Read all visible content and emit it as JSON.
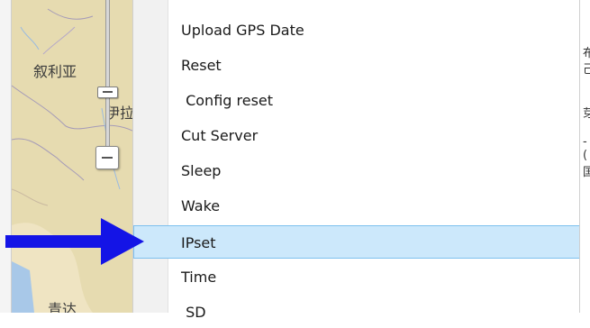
{
  "map": {
    "labels": [
      "叙利亚",
      "伊拉",
      "青达"
    ]
  },
  "menu": {
    "items": [
      {
        "label": "Upload GPS Date",
        "selected": false
      },
      {
        "label": "Reset",
        "selected": false
      },
      {
        "label": " Config reset",
        "selected": false
      },
      {
        "label": "Cut Server",
        "selected": false
      },
      {
        "label": "Sleep",
        "selected": false
      },
      {
        "label": "Wake",
        "selected": false
      },
      {
        "label": "IPset",
        "selected": true
      },
      {
        "label": "Time",
        "selected": false
      },
      {
        "label": " SD",
        "selected": false
      }
    ]
  },
  "right_pane": {
    "fragments": [
      "布",
      "己",
      "芽",
      "-(",
      "国"
    ]
  },
  "colors": {
    "selection_bg": "#cce8fb",
    "selection_border": "#7dc0ee",
    "arrow": "#1414e6",
    "map_land": "#e9dfb6",
    "map_water": "#a8c8e8"
  },
  "icons": {
    "zoom_out": "minus-icon",
    "zoom_handle": "slider-handle-icon",
    "pointer": "right-arrow-icon"
  }
}
